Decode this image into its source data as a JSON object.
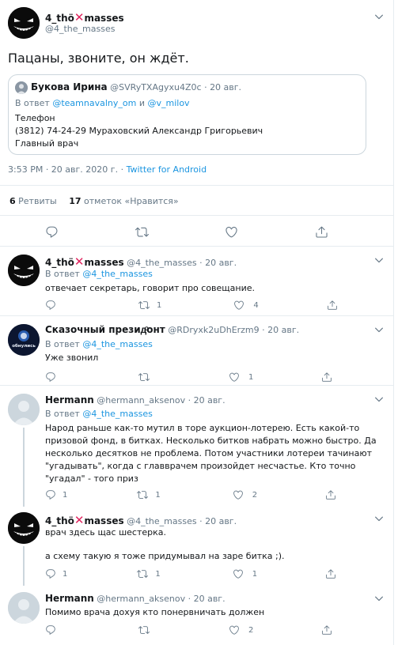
{
  "main": {
    "author_name_pre": "4_thö",
    "author_name_post": "masses",
    "author_handle": "@4_the_masses",
    "text": "Пацаны, звоните,  он ждёт.",
    "quote": {
      "author_name": "Букова Ирина",
      "author_handle": "@SVRyTXAgyxu4Z0c",
      "sep": "·",
      "date": "20 авг.",
      "reply_prefix": "В ответ",
      "reply_user1": "@teamnavalny_om",
      "reply_and": "и",
      "reply_user2": "@v_milov",
      "line1": "Телефон",
      "line2": "(3812) 74-24-29 Мураховский Александр Григорьевич",
      "line3": "Главный врач"
    },
    "timestamp": "3:53 PM · 20 авг. 2020 г. · ",
    "source": "Twitter for Android",
    "retweets_count": "6",
    "retweets_label": "Ретвиты",
    "likes_count": "17",
    "likes_label": "отметок «Нравится»"
  },
  "replies": [
    {
      "name_pre": "4_thö",
      "name_post": "masses",
      "handle": "@4_the_masses",
      "date": "20 авг.",
      "reply_prefix": "В ответ",
      "reply_to": "@4_the_masses",
      "text": "отвечает секретарь, говорит про совещание.",
      "replies_count": "",
      "retweets_count": "1",
      "likes_count": "4"
    },
    {
      "name": "Сказочный президͦонт",
      "handle": "@RDryxk2uDhErzm9",
      "date": "20 авг.",
      "reply_prefix": "В ответ",
      "reply_to": "@4_the_masses",
      "avatar_text": "обнулись",
      "text": "Уже звонил",
      "replies_count": "",
      "retweets_count": "",
      "likes_count": "1"
    },
    {
      "name": "Hermann",
      "handle": "@hermann_aksenov",
      "date": "20 авг.",
      "reply_prefix": "В ответ",
      "reply_to": "@4_the_masses",
      "text_lines": [
        "Народ раньше как-то мутил в торе аукцион-лотерею. Есть какой-то",
        "призовой фонд, в битках. Несколько битков набрать можно быстро. Да",
        "несколько десятков не проблема. Потом участники лотереи тачинают",
        "\"угадывать\", когда с главврачем произойдет несчастье. Кто точно",
        "\"угадал\" - того приз"
      ],
      "replies_count": "1",
      "retweets_count": "1",
      "likes_count": "2"
    },
    {
      "name_pre": "4_thö",
      "name_post": "masses",
      "handle": "@4_the_masses",
      "date": "20 авг.",
      "text1": "врач здесь щас шестерка.",
      "text2": "а схему такую я тоже придумывал на заре битка ;).",
      "replies_count": "1",
      "retweets_count": "1",
      "likes_count": "1"
    },
    {
      "name": "Hermann",
      "handle": "@hermann_aksenov",
      "date": "20 авг.",
      "text": "Помимо врача дохуя кто понервничать должен",
      "replies_count": "",
      "retweets_count": "",
      "likes_count": "2"
    }
  ],
  "sep": "·",
  "colors": {
    "link": "#1b95e0",
    "muted": "#657786",
    "border": "#e6ecf0",
    "cross": "#e0245e"
  }
}
